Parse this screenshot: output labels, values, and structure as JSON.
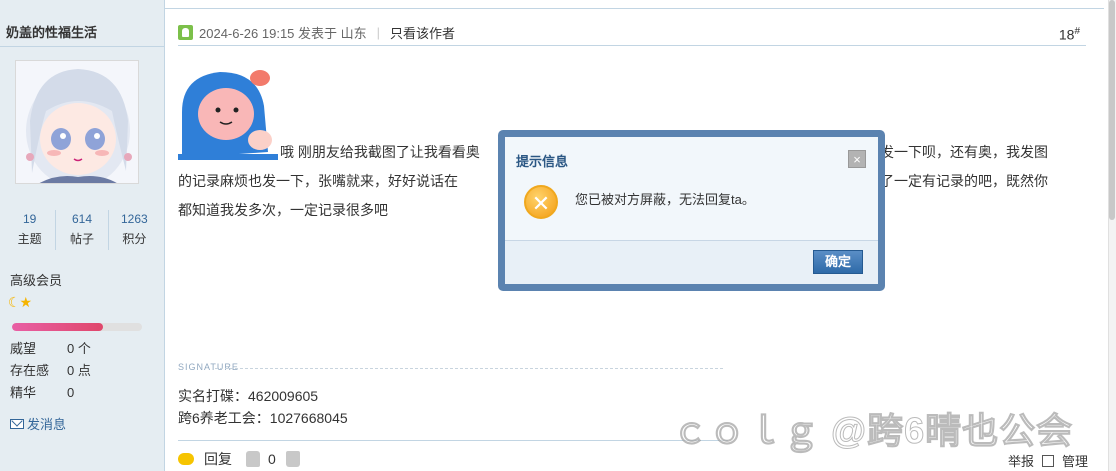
{
  "user": {
    "name": "奶盖的性福生活",
    "stats": [
      {
        "value": "19",
        "label": "主题"
      },
      {
        "value": "614",
        "label": "帖子"
      },
      {
        "value": "1263",
        "label": "积分"
      }
    ],
    "level": "高级会员",
    "level_progress": 0.7,
    "attrs": [
      {
        "key": "威望",
        "value": "0 个"
      },
      {
        "key": "存在感",
        "value": "0 点"
      },
      {
        "key": "精华",
        "value": "0"
      }
    ],
    "send_message": "发消息"
  },
  "post": {
    "meta": "2024-6-26 19:15 发表于 山东",
    "only_author": "只看该作者",
    "floor": "18",
    "floor_mark": "#",
    "text_left": "哦 刚朋友给我截图了让我看看奥",
    "text_line2": "的记录麻烦也发一下，张嘴就来，好好说话在",
    "text_line3": "都知道我发多次，一定记录很多吧",
    "text_right1": "发一下呗，还有奥，我发图",
    "text_right2": "了一定有记录的吧，既然你",
    "signature_label": "SIGNATURE",
    "signature_lines": [
      "实名打碟：462009605",
      "跨6养老工会：1027668045"
    ]
  },
  "footer": {
    "reply": "回复",
    "like_count": "0",
    "report": "举报",
    "manage": "管理"
  },
  "dialog": {
    "title": "提示信息",
    "close": "×",
    "message": "您已被对方屏蔽，无法回复ta。",
    "ok": "确定"
  },
  "watermark": "ｃｏｌｇ @跨6晴也公会"
}
